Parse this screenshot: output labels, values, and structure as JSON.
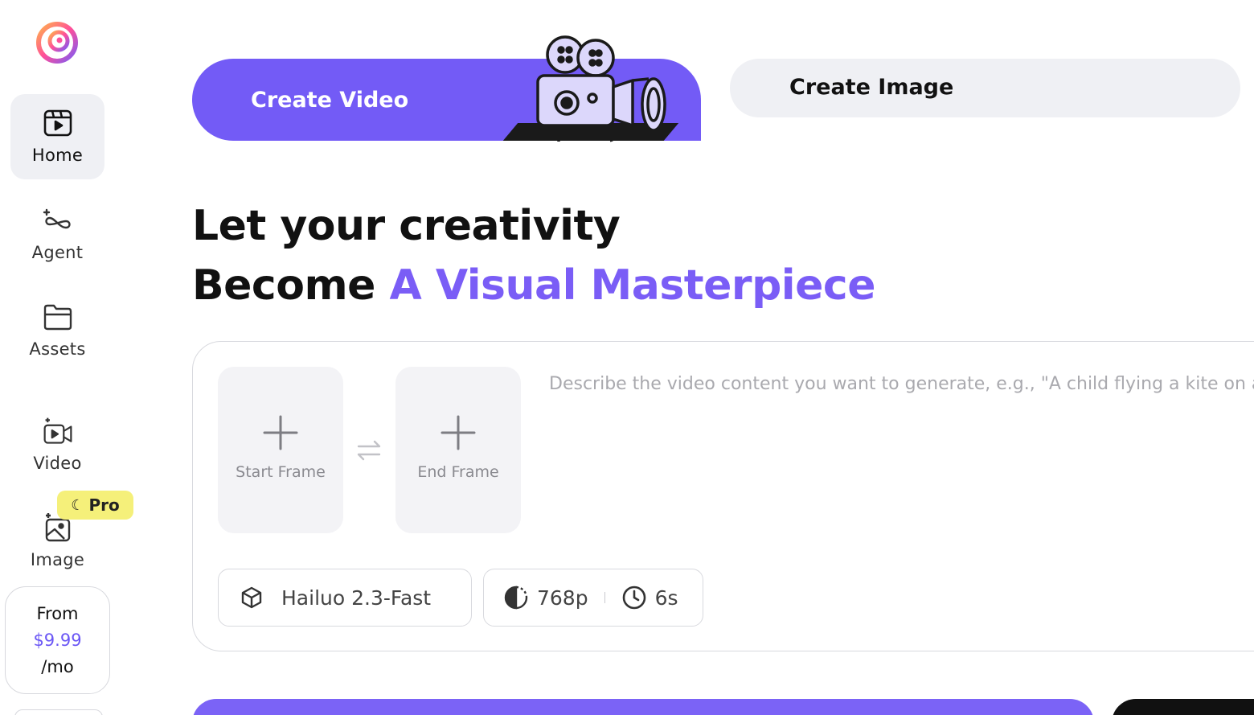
{
  "sidebar": {
    "items": [
      {
        "label": "Home",
        "icon": "home-icon",
        "active": true
      },
      {
        "label": "Agent",
        "icon": "agent-icon"
      },
      {
        "label": "Assets",
        "icon": "folder-icon"
      },
      {
        "label": "Video",
        "icon": "video-icon"
      },
      {
        "label": "Image",
        "icon": "image-icon"
      }
    ],
    "pro_badge": "Pro",
    "pricing": {
      "prefix": "From",
      "amount": "$9.99",
      "suffix": "/mo"
    }
  },
  "tabs": {
    "video": "Create Video",
    "image": "Create Image"
  },
  "headline": {
    "line1": "Let your creativity",
    "line2_prefix": "Become ",
    "line2_accent": "A Visual Masterpiece"
  },
  "prompt": {
    "start_frame": "Start Frame",
    "end_frame": "End Frame",
    "placeholder": "Describe the video content you want to generate, e.g., \"A child flying a kite on a sunny beach\"",
    "model": "Hailuo 2.3-Fast",
    "resolution": "768p",
    "duration": "6s"
  },
  "colors": {
    "accent": "#735bf6",
    "accent_text": "#7a5df6",
    "pro_badge": "#f5f07a",
    "surface": "#eff0f4"
  }
}
